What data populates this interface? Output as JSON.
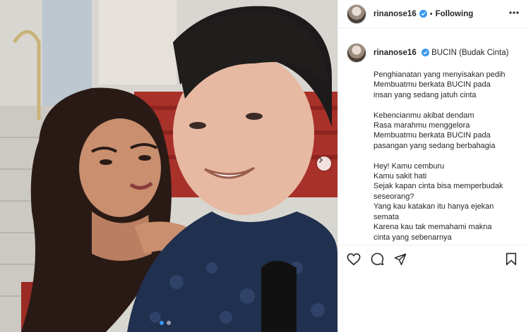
{
  "post": {
    "username": "rinanose16",
    "follow_label": "Following",
    "separator": "•",
    "caption_title": "BUCIN (Budak Cinta)",
    "caption_lines": [
      "Penghianatan yang menyisakan pedih",
      "Membuatmu berkata BUCIN pada",
      "insan yang sedang jatuh cinta",
      "",
      "Kebencianmu akibat dendam",
      "Rasa marahmu menggelora",
      "Membuatmu berkata BUCIN pada",
      "pasangan yang sedang berbahagia",
      "",
      "Hey! Kamu cemburu",
      "Kamu sakit hati",
      "Sejak kapan cinta bisa memperbudak",
      "seseorang?",
      "Yang kau katakan itu hanya ejekan",
      "semata",
      "Karena kau tak memahami makna",
      "cinta yang sebenarnya"
    ],
    "carousel": {
      "slides": 2,
      "active": 1
    }
  },
  "icons": {
    "verified": "verified-badge-icon",
    "more": "more-options-icon",
    "like": "heart-icon",
    "comment": "comment-icon",
    "share": "paper-plane-icon",
    "save": "bookmark-icon",
    "next": "chevron-right-icon"
  },
  "colors": {
    "accent": "#3897f0",
    "text": "#262626",
    "border": "#efefef"
  }
}
